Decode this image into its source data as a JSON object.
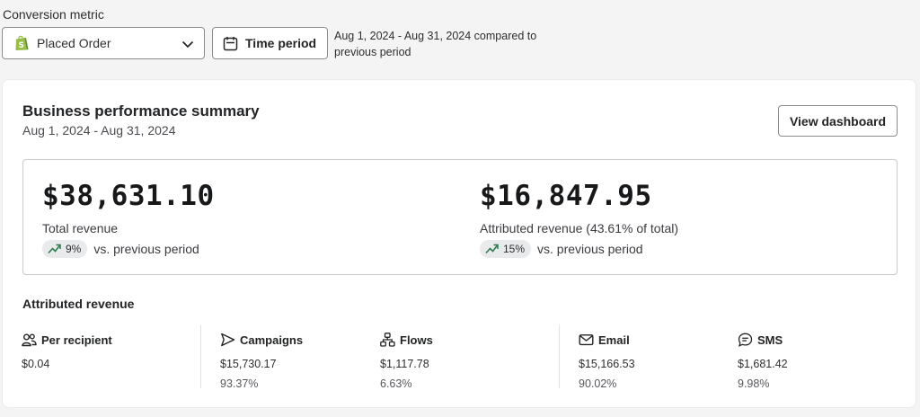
{
  "filters": {
    "metric_label": "Conversion metric",
    "metric_value": "Placed Order",
    "time_button": "Time period",
    "date_note": "Aug 1, 2024 - Aug 31, 2024 compared to previous period"
  },
  "summary": {
    "title": "Business performance summary",
    "date_range": "Aug 1, 2024 - Aug 31, 2024",
    "dashboard_button": "View dashboard",
    "total": {
      "value": "$38,631.10",
      "label": "Total revenue",
      "change": "9%",
      "comparison": "vs. previous period"
    },
    "attributed": {
      "value": "$16,847.95",
      "label": "Attributed revenue (43.61% of total)",
      "change": "15%",
      "comparison": "vs. previous period"
    }
  },
  "attributed_revenue": {
    "title": "Attributed revenue",
    "stats": [
      {
        "label": "Per recipient",
        "icon": "people-icon",
        "value": "$0.04",
        "share": ""
      },
      {
        "label": "Campaigns",
        "icon": "send-icon",
        "value": "$15,730.17",
        "share": "93.37%"
      },
      {
        "label": "Flows",
        "icon": "flow-icon",
        "value": "$1,117.78",
        "share": "6.63%"
      },
      {
        "label": "Email",
        "icon": "mail-icon",
        "value": "$15,166.53",
        "share": "90.02%"
      },
      {
        "label": "SMS",
        "icon": "chat-icon",
        "value": "$1,681.42",
        "share": "9.98%"
      }
    ]
  },
  "colors": {
    "trend_up": "#2e7d4f",
    "shopify_green": "#5e8e3e"
  }
}
